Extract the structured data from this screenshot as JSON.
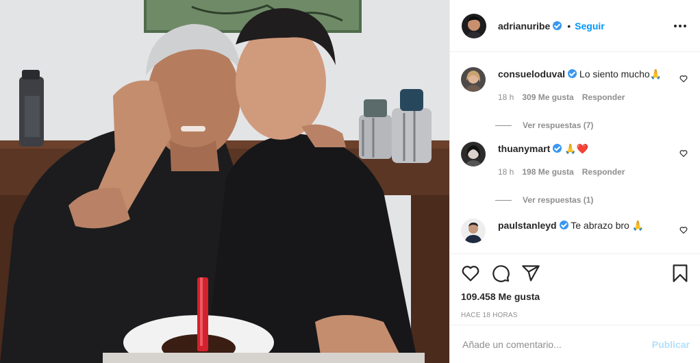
{
  "post": {
    "photo_alt": "",
    "author": {
      "username": "adrianuribe",
      "verified": true,
      "follow_label": "Seguir",
      "separator": "•"
    },
    "comments": [
      {
        "username": "consueloduval",
        "verified": true,
        "text": "Lo siento mucho🙏",
        "time": "18 h",
        "likes": "309 Me gusta",
        "reply_label": "Responder",
        "view_replies": "Ver respuestas (7)"
      },
      {
        "username": "thuanymart",
        "verified": true,
        "text": "🙏❤️",
        "time": "18 h",
        "likes": "198 Me gusta",
        "reply_label": "Responder",
        "view_replies": "Ver respuestas (1)"
      },
      {
        "username": "paulstanleyd",
        "verified": true,
        "text": "Te abrazo bro 🙏"
      }
    ],
    "likes_text": "109.458 Me gusta",
    "time_ago": "HACE 18 HORAS",
    "comment_placeholder": "Añade un comentario...",
    "publish_label": "Publicar"
  },
  "colors": {
    "accent": "#0095f6",
    "verified": "#3897f0",
    "muted": "#8e8e8e",
    "publish_disabled": "#b2dffc"
  },
  "icons": [
    "more-icon",
    "heart-icon",
    "comment-icon",
    "share-icon",
    "bookmark-icon",
    "verified-badge-icon"
  ]
}
